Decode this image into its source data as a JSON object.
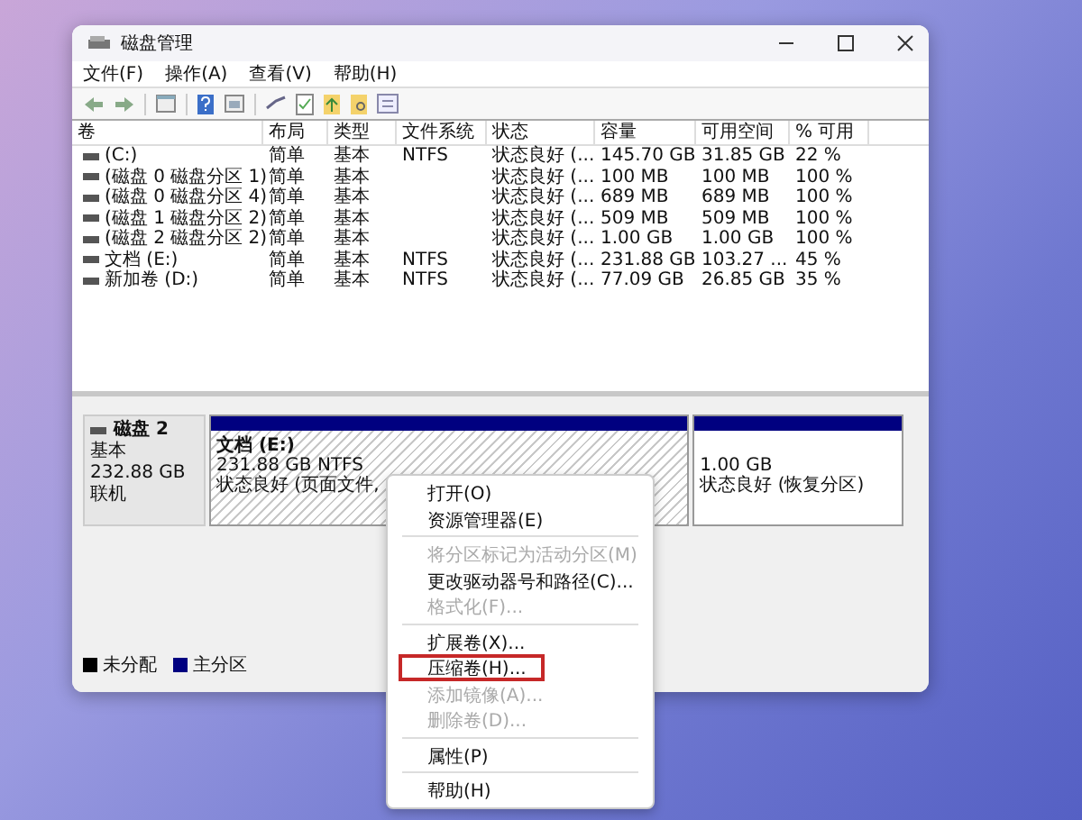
{
  "window": {
    "title": "磁盘管理"
  },
  "menu": [
    "文件(F)",
    "操作(A)",
    "查看(V)",
    "帮助(H)"
  ],
  "table": {
    "columns": [
      "卷",
      "布局",
      "类型",
      "文件系统",
      "状态",
      "容量",
      "可用空间",
      "% 可用"
    ],
    "rows": [
      [
        "(C:)",
        "简单",
        "基本",
        "NTFS",
        "状态良好 (...",
        "145.70 GB",
        "31.85 GB",
        "22 %"
      ],
      [
        "(磁盘 0 磁盘分区 1)",
        "简单",
        "基本",
        "",
        "状态良好 (...",
        "100 MB",
        "100 MB",
        "100 %"
      ],
      [
        "(磁盘 0 磁盘分区 4)",
        "简单",
        "基本",
        "",
        "状态良好 (...",
        "689 MB",
        "689 MB",
        "100 %"
      ],
      [
        "(磁盘 1 磁盘分区 2)",
        "简单",
        "基本",
        "",
        "状态良好 (...",
        "509 MB",
        "509 MB",
        "100 %"
      ],
      [
        "(磁盘 2 磁盘分区 2)",
        "简单",
        "基本",
        "",
        "状态良好 (...",
        "1.00 GB",
        "1.00 GB",
        "100 %"
      ],
      [
        "文档 (E:)",
        "简单",
        "基本",
        "NTFS",
        "状态良好 (...",
        "231.88 GB",
        "103.27 ...",
        "45 %"
      ],
      [
        "新加卷 (D:)",
        "简单",
        "基本",
        "NTFS",
        "状态良好 (...",
        "77.09 GB",
        "26.85 GB",
        "35 %"
      ]
    ]
  },
  "disk": {
    "name": "磁盘 2",
    "type": "基本",
    "size": "232.88 GB",
    "status": "联机",
    "partitions": [
      {
        "label": "文档 (E:)",
        "size": "231.88 GB NTFS",
        "status": "状态良好 (页面文件,",
        "selected": true
      },
      {
        "size": "1.00 GB",
        "status": "状态良好 (恢复分区)",
        "selected": false
      }
    ]
  },
  "legend": [
    {
      "label": "未分配",
      "color": "#000000"
    },
    {
      "label": "主分区",
      "color": "#000080"
    }
  ],
  "context_menu": [
    [
      {
        "label": "打开(O)",
        "disabled": false,
        "outlined": false
      },
      {
        "label": "资源管理器(E)",
        "disabled": false,
        "outlined": false
      }
    ],
    [
      {
        "label": "将分区标记为活动分区(M)",
        "disabled": true,
        "outlined": false
      },
      {
        "label": "更改驱动器号和路径(C)...",
        "disabled": false,
        "outlined": false
      },
      {
        "label": "格式化(F)...",
        "disabled": true,
        "outlined": false
      }
    ],
    [
      {
        "label": "扩展卷(X)...",
        "disabled": false,
        "outlined": false
      },
      {
        "label": "压缩卷(H)...",
        "disabled": false,
        "outlined": true
      },
      {
        "label": "添加镜像(A)...",
        "disabled": true,
        "outlined": false
      },
      {
        "label": "删除卷(D)...",
        "disabled": true,
        "outlined": false
      }
    ],
    [
      {
        "label": "属性(P)",
        "disabled": false,
        "outlined": false
      }
    ],
    [
      {
        "label": "帮助(H)",
        "disabled": false,
        "outlined": false
      }
    ]
  ]
}
